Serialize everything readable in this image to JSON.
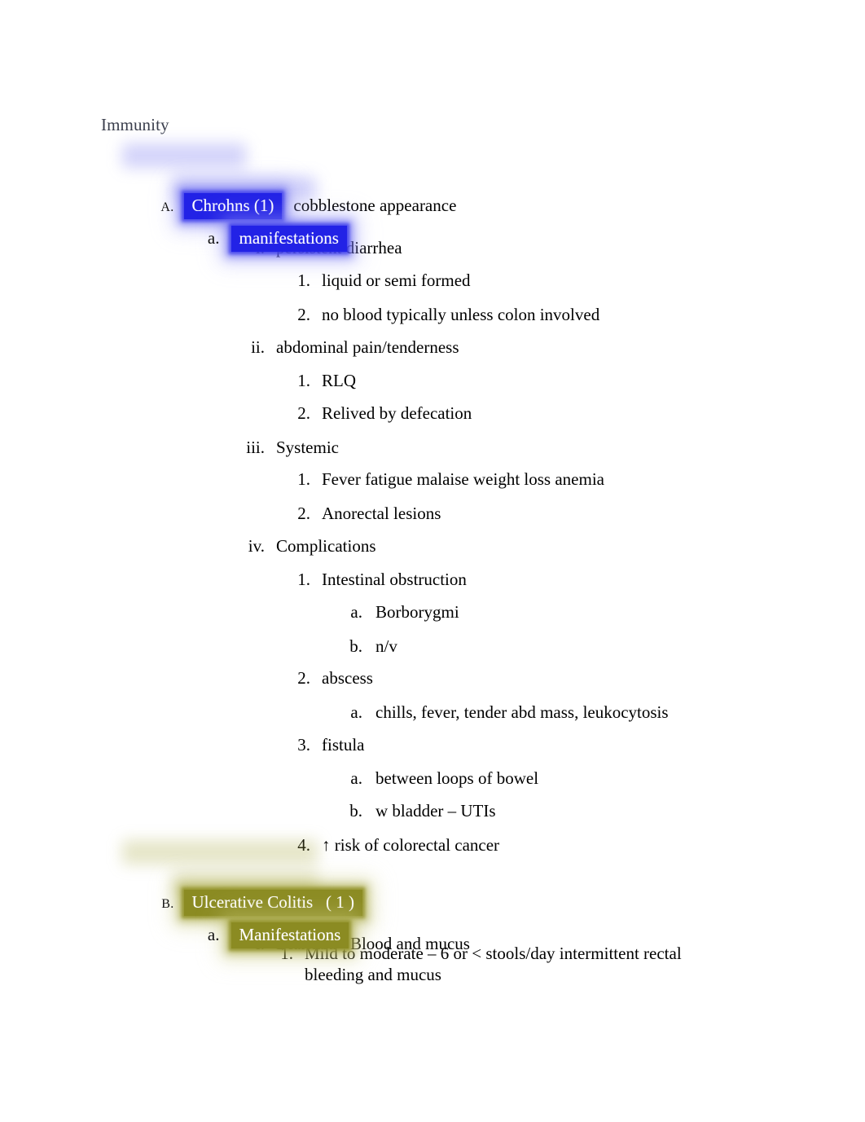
{
  "document": {
    "title": "Immunity",
    "title_color": "#3b3f4d",
    "background": "#ffffff",
    "highlight_blue": "#2222e6",
    "highlight_olive": "#8b8b22",
    "highlight_text_color": "#ffffff"
  },
  "outline": [
    {
      "id": "A",
      "marker": "A.",
      "level": 1,
      "highlight": "blue",
      "highlighted_text": "Chrohns (1)",
      "trailing_text": "cobblestone appearance"
    },
    {
      "id": "A-a",
      "marker": "a.",
      "level": 2,
      "highlight": "blue",
      "highlighted_text": "manifestations",
      "trailing_text": ""
    },
    {
      "id": "A-a-i",
      "marker": "i.",
      "level": 3,
      "text": "persistent diarrhea"
    },
    {
      "id": "A-a-i-1",
      "marker": "1.",
      "level": 4,
      "text": "liquid or semi formed"
    },
    {
      "id": "A-a-i-2",
      "marker": "2.",
      "level": 4,
      "text": "no blood typically unless colon involved"
    },
    {
      "id": "A-a-ii",
      "marker": "ii.",
      "level": 3,
      "text": "abdominal pain/tenderness"
    },
    {
      "id": "A-a-ii-1",
      "marker": "1.",
      "level": 4,
      "text": "RLQ"
    },
    {
      "id": "A-a-ii-2",
      "marker": "2.",
      "level": 4,
      "text": "Relived by defecation"
    },
    {
      "id": "A-a-iii",
      "marker": "iii.",
      "level": 3,
      "text": "Systemic"
    },
    {
      "id": "A-a-iii-1",
      "marker": "1.",
      "level": 4,
      "text": "Fever fatigue malaise weight loss anemia"
    },
    {
      "id": "A-a-iii-2",
      "marker": "2.",
      "level": 4,
      "text": "Anorectal lesions"
    },
    {
      "id": "A-a-iv",
      "marker": "iv.",
      "level": 3,
      "text": "Complications"
    },
    {
      "id": "A-a-iv-1",
      "marker": "1.",
      "level": 4,
      "text": "Intestinal obstruction"
    },
    {
      "id": "A-a-iv-1-a",
      "marker": "a.",
      "level": 5,
      "text": "Borborygmi"
    },
    {
      "id": "A-a-iv-1-b",
      "marker": "b.",
      "level": 5,
      "text": "n/v"
    },
    {
      "id": "A-a-iv-2",
      "marker": "2.",
      "level": 4,
      "text": "abscess"
    },
    {
      "id": "A-a-iv-2-a",
      "marker": "a.",
      "level": 5,
      "text": "chills, fever, tender abd mass, leukocytosis"
    },
    {
      "id": "A-a-iv-3",
      "marker": "3.",
      "level": 4,
      "text": "fistula"
    },
    {
      "id": "A-a-iv-3-a",
      "marker": "a.",
      "level": 5,
      "text": "between loops of bowel"
    },
    {
      "id": "A-a-iv-3-b",
      "marker": "b.",
      "level": 5,
      "text": "w bladder – UTIs"
    },
    {
      "id": "A-a-iv-4",
      "marker": "4.",
      "level": 4,
      "text": "↑ risk of colorectal cancer"
    },
    {
      "id": "B",
      "marker": "B.",
      "level": 1,
      "highlight": "olive",
      "highlighted_text": "Ulcerative Colitis   ( 1 )",
      "trailing_text": ""
    },
    {
      "id": "B-a",
      "marker": "a.",
      "level": 2,
      "highlight": "olive",
      "highlighted_text": "Manifestations",
      "trailing_text": ""
    },
    {
      "id": "B-a-i",
      "marker": "i.",
      "level": 3,
      "text": "Diarrhea - Blood and mucus"
    },
    {
      "id": "B-a-i-1",
      "marker": "1.",
      "level": 4,
      "text": "Mild to moderate – 6 or < stools/day intermittent rectal bleeding and mucus"
    }
  ]
}
